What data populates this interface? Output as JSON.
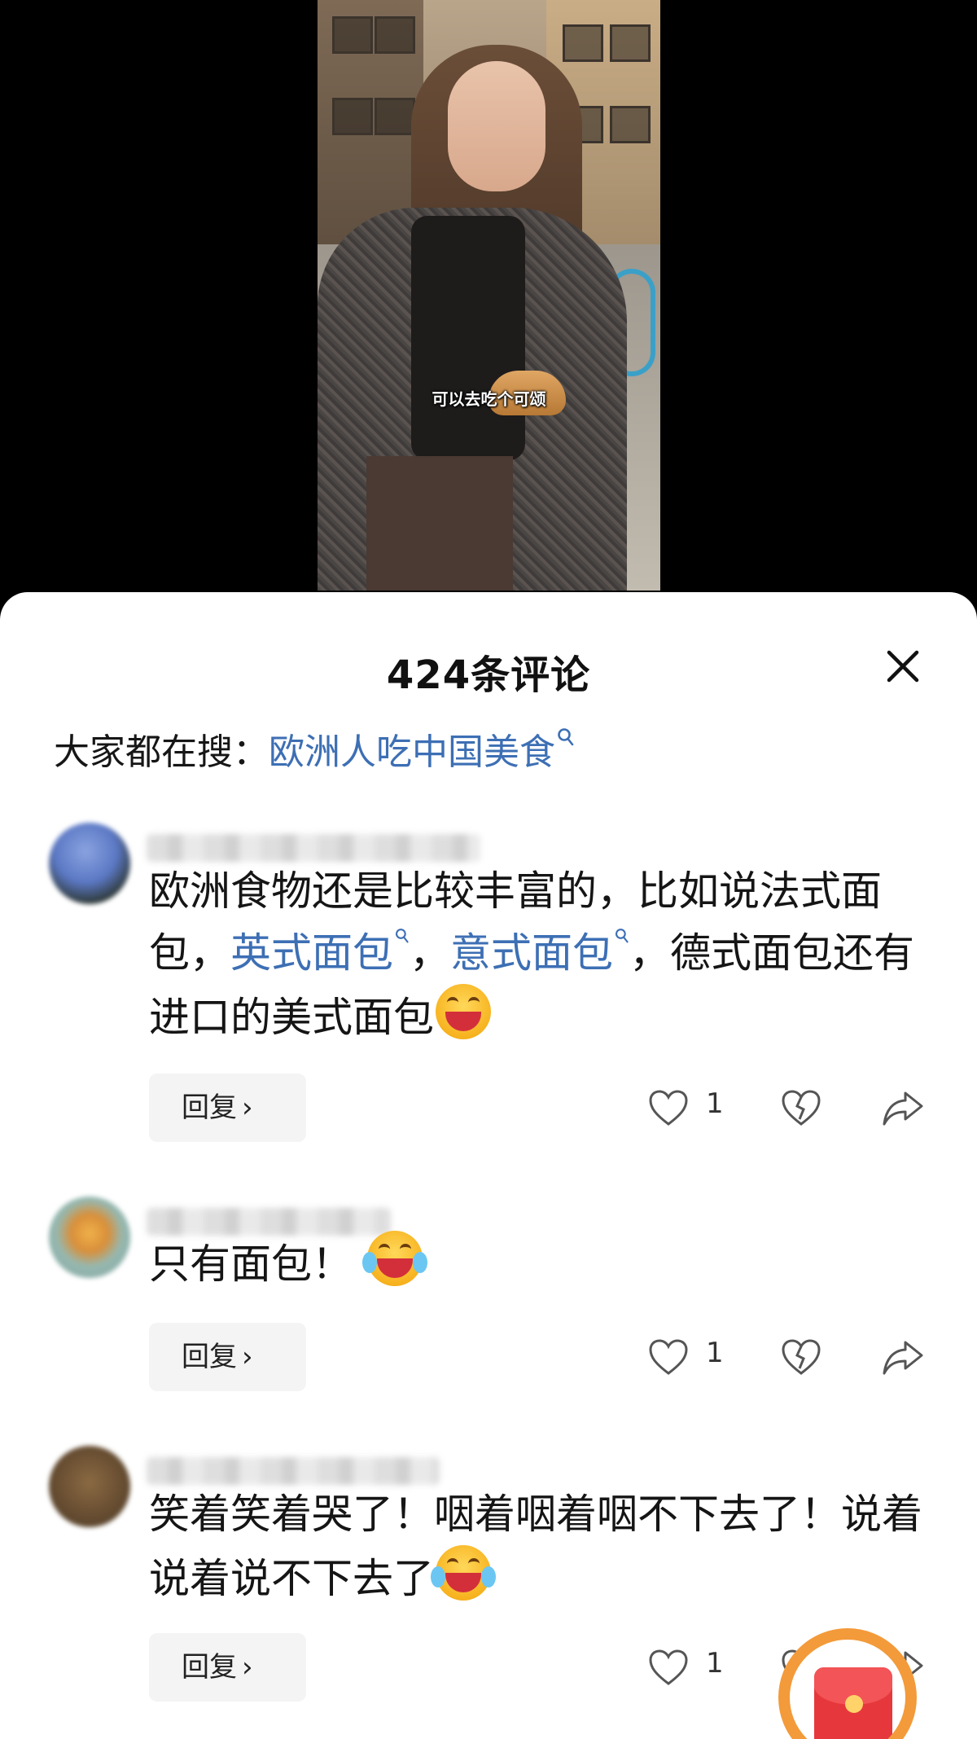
{
  "video": {
    "subtitle": "可以去吃个可颂"
  },
  "comments_panel": {
    "title": "424条评论",
    "trending_label": "大家都在搜：",
    "trending_query": "欧洲人吃中国美食",
    "comments": [
      {
        "segments": [
          "欧洲食物还是比较丰富的，比如说法式面包，",
          "英式面包",
          "，",
          "意式面包",
          "，德式面包还有进口的美式面包"
        ],
        "emoji": "grinning-squinting-face",
        "reply_label": "回复",
        "like_count": "1"
      },
      {
        "text": "只有面包！",
        "emoji": "rolling-on-floor-laughing",
        "reply_label": "回复",
        "like_count": "1"
      },
      {
        "text": "笑着笑着哭了！咽着咽着咽不下去了！说着说着说不下去了",
        "emoji": "rolling-on-floor-laughing",
        "reply_label": "回复",
        "like_count": "1"
      }
    ]
  },
  "icons": {
    "close": "close-icon",
    "search": "search-icon",
    "like": "heart-icon",
    "dislike": "broken-heart-icon",
    "share": "share-icon",
    "red_packet": "red-packet-icon"
  },
  "colors": {
    "link_blue": "#3d6fb4",
    "reply_bg": "#f4f4f4",
    "red_packet_ring": "#f39a3a",
    "red_packet": "#e6383c"
  }
}
